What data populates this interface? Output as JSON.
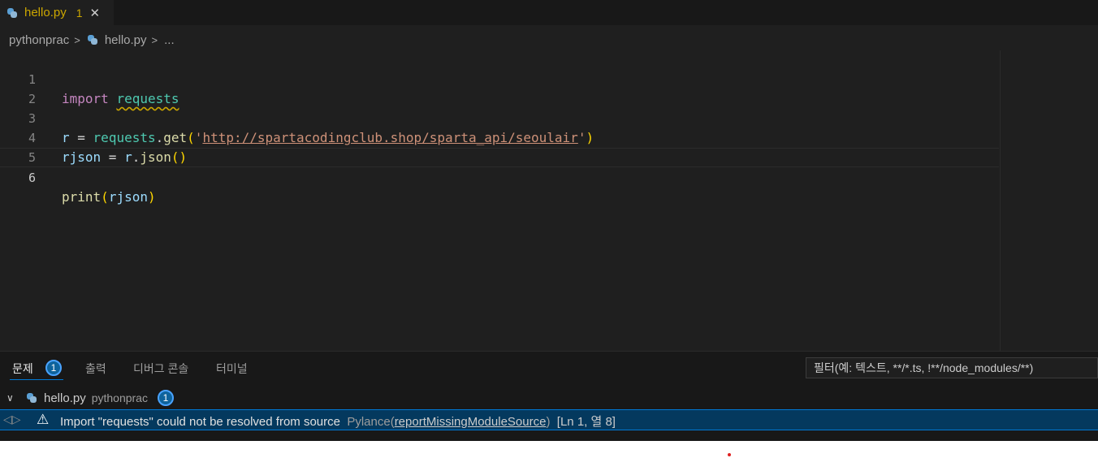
{
  "tab": {
    "file_name": "hello.py",
    "problem_count": "1",
    "close_glyph": "✕"
  },
  "breadcrumb": {
    "folder": "pythonprac",
    "file": "hello.py",
    "more": "..."
  },
  "editor": {
    "lines": [
      {
        "number": "1",
        "tokens": {
          "kw": "import",
          "mod": "requests"
        }
      },
      {
        "number": "2"
      },
      {
        "number": "3",
        "tokens": {
          "r": "r",
          "eq": " = ",
          "obj": "requests",
          "dot": ".",
          "fn": "get",
          "open": "(",
          "q1": "'",
          "url": "http://spartacodingclub.shop/sparta_api/seoulair",
          "q2": "'",
          "close": ")"
        }
      },
      {
        "number": "4",
        "tokens": {
          "var": "rjson",
          "eq": " = ",
          "obj": "r",
          "dot": ".",
          "fn": "json",
          "parens": "()"
        }
      },
      {
        "number": "5"
      },
      {
        "number": "6",
        "tokens": {
          "fn": "print",
          "open": "(",
          "arg": "rjson",
          "close": ")"
        }
      }
    ],
    "active_line": "6"
  },
  "panel": {
    "tabs": [
      {
        "label": "문제",
        "badge": "1"
      },
      {
        "label": "출력"
      },
      {
        "label": "디버그 콘솔"
      },
      {
        "label": "터미널"
      }
    ],
    "filter_placeholder": "필터(예: 텍스트, **/*.ts, !**/node_modules/**)",
    "file_group": {
      "file": "hello.py",
      "folder": "pythonprac",
      "count": "1"
    },
    "problem": {
      "message": "Import \"requests\" could not be resolved from source",
      "source": "Pylance(",
      "code": "reportMissingModuleSource",
      "source_close": ")",
      "position": "[Ln 1, 열 8]"
    }
  },
  "colors": {
    "accent": "#0078d4",
    "warning": "#cca700",
    "background": "#1f1f1f"
  },
  "icons": [
    "python-file-icon",
    "close-icon",
    "chevron-right-icon",
    "chevron-down-icon",
    "warning-icon"
  ]
}
